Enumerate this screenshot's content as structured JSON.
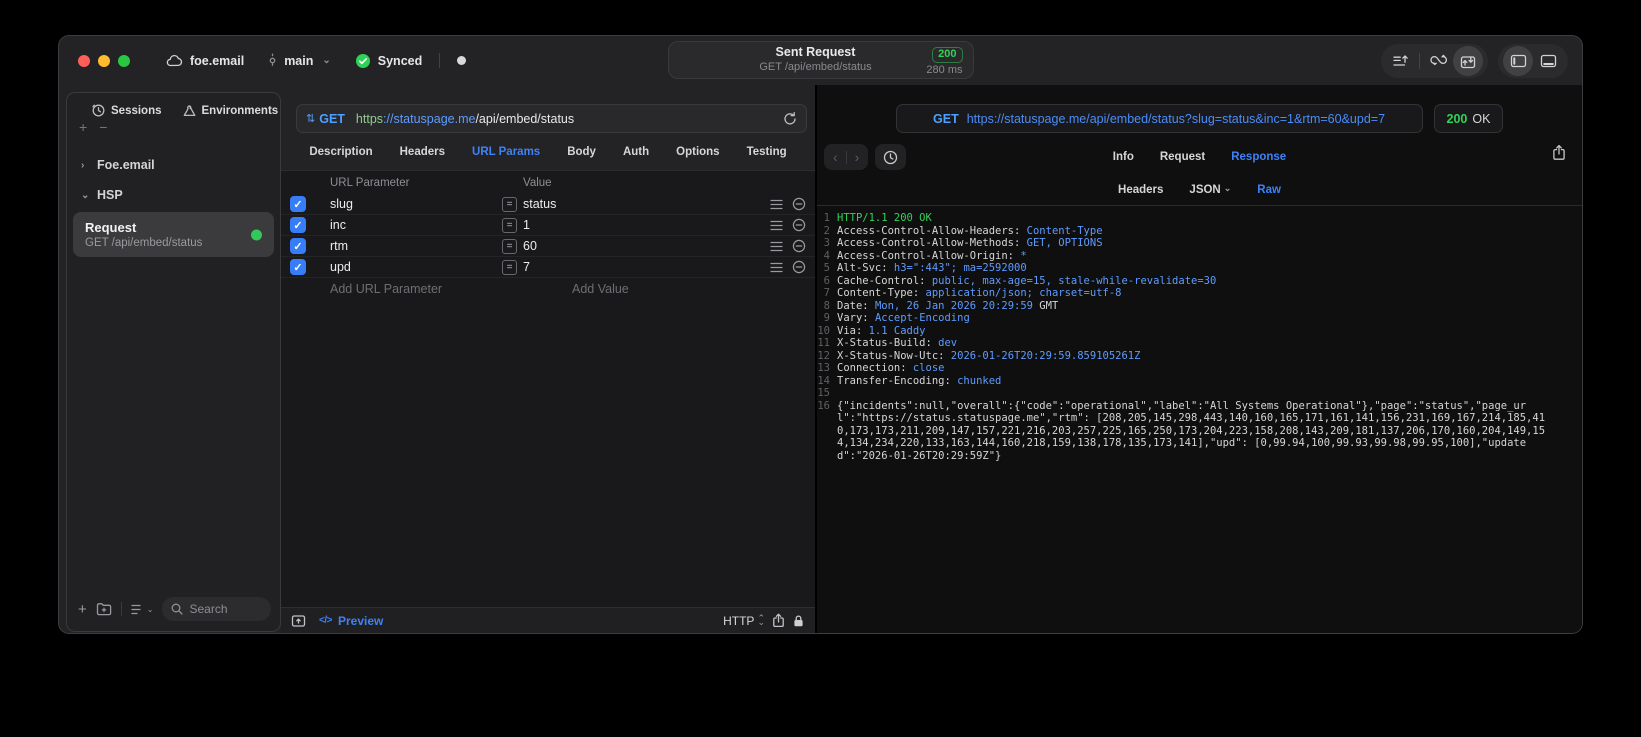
{
  "titlebar": {
    "project": "foe.email",
    "branch": "main",
    "sync_label": "Synced",
    "request_title": "Sent Request",
    "request_subtitle": "GET /api/embed/status",
    "status_code": "200",
    "duration": "280 ms"
  },
  "sidebar": {
    "tabs": [
      {
        "label": "Sessions"
      },
      {
        "label": "Environments"
      }
    ],
    "add_glyph": "+",
    "remove_glyph": "−",
    "tree": [
      {
        "label": "Foe.email",
        "chevron": "›"
      },
      {
        "label": "HSP",
        "chevron": "⌄"
      }
    ],
    "request_item": {
      "title": "Request",
      "subtitle": "GET /api/embed/status"
    },
    "search_placeholder": "Search"
  },
  "request_editor": {
    "method": "GET",
    "url": {
      "scheme": "https",
      "host": "://statuspage.me",
      "path": "/api/embed/status"
    },
    "tabs": [
      {
        "label": "Description"
      },
      {
        "label": "Headers"
      },
      {
        "label": "URL Params",
        "active": true
      },
      {
        "label": "Body"
      },
      {
        "label": "Auth"
      },
      {
        "label": "Options"
      },
      {
        "label": "Testing"
      }
    ],
    "params": {
      "columns": [
        "URL Parameter",
        "Value"
      ],
      "rows": [
        {
          "name": "slug",
          "value": "status",
          "checked": true
        },
        {
          "name": "inc",
          "value": "1",
          "checked": true
        },
        {
          "name": "rtm",
          "value": "60",
          "checked": true
        },
        {
          "name": "upd",
          "value": "7",
          "checked": true
        }
      ],
      "add_name_placeholder": "Add URL Parameter",
      "add_value_placeholder": "Add Value"
    },
    "footer": {
      "preview_glyph": "</>",
      "preview_label": "Preview",
      "protocol": "HTTP"
    }
  },
  "response_viewer": {
    "method": "GET",
    "url": "https://statuspage.me/api/embed/status?slug=status&inc=1&rtm=60&upd=7",
    "status_code": "200",
    "status_text": "OK",
    "tabs": [
      {
        "label": "Info"
      },
      {
        "label": "Request"
      },
      {
        "label": "Response",
        "active": true
      }
    ],
    "format_tabs": [
      {
        "label": "Headers"
      },
      {
        "label": "JSON",
        "dropdown": true
      },
      {
        "label": "Raw",
        "active": true
      }
    ],
    "body": {
      "lines": [
        {
          "n": "1",
          "segs": [
            {
              "t": "HTTP/1.1 200 OK",
              "c": "status"
            }
          ]
        },
        {
          "n": "2",
          "segs": [
            {
              "t": "Access-Control-Allow-Headers: ",
              "c": "key"
            },
            {
              "t": "Content-Type",
              "c": "val"
            }
          ]
        },
        {
          "n": "3",
          "segs": [
            {
              "t": "Access-Control-Allow-Methods: ",
              "c": "key"
            },
            {
              "t": "GET, OPTIONS",
              "c": "val"
            }
          ]
        },
        {
          "n": "4",
          "segs": [
            {
              "t": "Access-Control-Allow-Origin: ",
              "c": "key"
            },
            {
              "t": "*",
              "c": "val"
            }
          ]
        },
        {
          "n": "5",
          "segs": [
            {
              "t": "Alt-Svc: ",
              "c": "key"
            },
            {
              "t": "h3=\":443\"; ma=2592000",
              "c": "val"
            }
          ]
        },
        {
          "n": "6",
          "segs": [
            {
              "t": "Cache-Control: ",
              "c": "key"
            },
            {
              "t": "public, max-age=15, stale-while-revalidate=30",
              "c": "val"
            }
          ]
        },
        {
          "n": "7",
          "segs": [
            {
              "t": "Content-Type: ",
              "c": "key"
            },
            {
              "t": "application/json; charset=utf-8",
              "c": "val"
            }
          ]
        },
        {
          "n": "8",
          "segs": [
            {
              "t": "Date: ",
              "c": "key"
            },
            {
              "t": "Mon, 26 Jan 2026 20:29:59",
              "c": "val"
            },
            {
              "t": " GMT",
              "c": "key"
            }
          ]
        },
        {
          "n": "9",
          "segs": [
            {
              "t": "Vary: ",
              "c": "key"
            },
            {
              "t": "Accept-Encoding",
              "c": "val"
            }
          ]
        },
        {
          "n": "10",
          "segs": [
            {
              "t": "Via: ",
              "c": "key"
            },
            {
              "t": "1.1 Caddy",
              "c": "val"
            }
          ]
        },
        {
          "n": "11",
          "segs": [
            {
              "t": "X-Status-Build: ",
              "c": "key"
            },
            {
              "t": "dev",
              "c": "val"
            }
          ]
        },
        {
          "n": "12",
          "segs": [
            {
              "t": "X-Status-Now-Utc: ",
              "c": "key"
            },
            {
              "t": "2026-01-26T20:29:59.859105261Z",
              "c": "val"
            }
          ]
        },
        {
          "n": "13",
          "segs": [
            {
              "t": "Connection: ",
              "c": "key"
            },
            {
              "t": "close",
              "c": "val"
            }
          ]
        },
        {
          "n": "14",
          "segs": [
            {
              "t": "Transfer-Encoding: ",
              "c": "key"
            },
            {
              "t": "chunked",
              "c": "val"
            }
          ]
        },
        {
          "n": "15",
          "segs": []
        },
        {
          "n": "16",
          "segs": [
            {
              "t": "{\"incidents\":null,\"overall\":{\"code\":\"operational\",\"label\":\"All Systems Operational\"},\"page\":\"status\",\"page_url\":\"https://status.statuspage.me\",\"rtm\": [208,205,145,298,443,140,160,165,171,161,141,156,231,169,167,214,185,410,173,173,211,209,147,157,221,216,203,257,225,165,250,173,204,223,158,208,143,209,181,137,206,170,160,204,149,154,134,234,220,133,163,144,160,218,159,138,178,135,173,141],\"upd\": [0,99.94,100,99.93,99.98,99.95,100],\"updated\":\"2026-01-26T20:29:59Z\"}",
              "c": "plain"
            }
          ]
        }
      ]
    }
  },
  "colors": {
    "accent_blue": "#3e82f7",
    "status_green": "#32d158",
    "checkbox_blue": "#377df7"
  }
}
